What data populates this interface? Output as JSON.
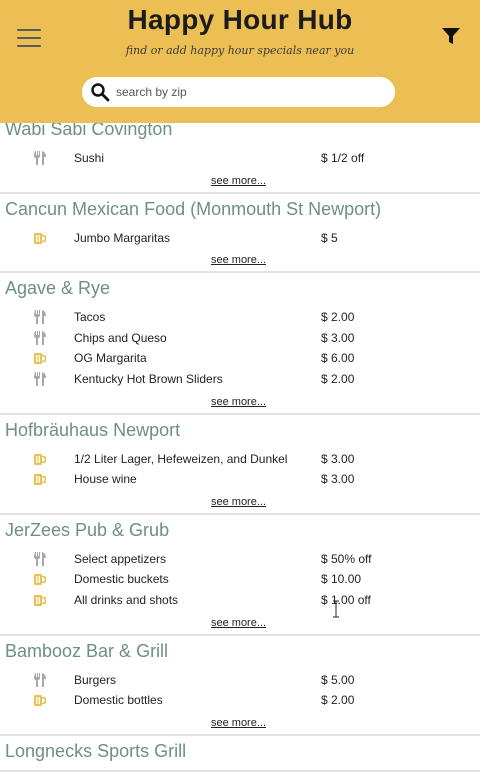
{
  "header": {
    "title": "Happy Hour Hub",
    "tagline": "find or add happy hour specials near you",
    "search_placeholder": "search by zip"
  },
  "colors": {
    "header_bg": "#ecbf55",
    "venue_name": "#6e8f86",
    "food_icon": "#a9a9a9",
    "drink_icon": "#e8c152"
  },
  "see_more_label": "see more...",
  "venues": [
    {
      "name": "Wabi Sabi Covington",
      "deals": [
        {
          "icon": "food-icon",
          "desc": "Sushi",
          "price": "$ 1/2 off"
        }
      ]
    },
    {
      "name": "Cancun Mexican Food (Monmouth St Newport)",
      "deals": [
        {
          "icon": "drink-icon",
          "desc": "Jumbo Margaritas",
          "price": "$ 5"
        }
      ]
    },
    {
      "name": "Agave & Rye",
      "deals": [
        {
          "icon": "food-icon",
          "desc": "Tacos",
          "price": "$ 2.00"
        },
        {
          "icon": "food-icon",
          "desc": "Chips and Queso",
          "price": "$ 3.00"
        },
        {
          "icon": "drink-icon",
          "desc": "OG Margarita",
          "price": "$ 6.00"
        },
        {
          "icon": "food-icon",
          "desc": "Kentucky Hot Brown Sliders",
          "price": "$ 2.00"
        }
      ]
    },
    {
      "name": "Hofbräuhaus Newport",
      "deals": [
        {
          "icon": "drink-icon",
          "desc": "1/2 Liter Lager, Hefeweizen, and Dunkel",
          "price": "$ 3.00"
        },
        {
          "icon": "drink-icon",
          "desc": "House wine",
          "price": "$ 3.00"
        }
      ]
    },
    {
      "name": "JerZees Pub & Grub",
      "deals": [
        {
          "icon": "food-icon",
          "desc": "Select appetizers",
          "price": "$ 50% off"
        },
        {
          "icon": "drink-icon",
          "desc": "Domestic buckets",
          "price": "$ 10.00"
        },
        {
          "icon": "drink-icon",
          "desc": "All drinks and shots",
          "price": "$ 1.00 off"
        }
      ]
    },
    {
      "name": "Bambooz Bar & Grill",
      "deals": [
        {
          "icon": "food-icon",
          "desc": "Burgers",
          "price": "$ 5.00"
        },
        {
          "icon": "drink-icon",
          "desc": "Domestic bottles",
          "price": "$ 2.00"
        }
      ]
    },
    {
      "name": "Longnecks Sports Grill",
      "deals": []
    }
  ]
}
